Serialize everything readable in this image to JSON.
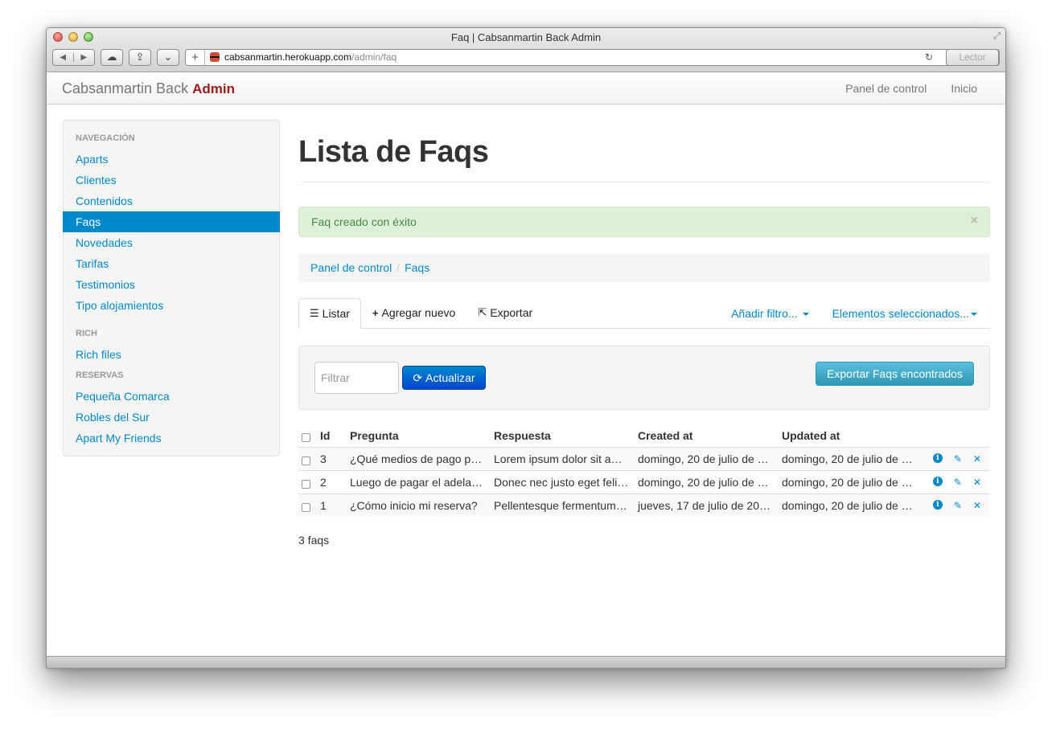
{
  "window": {
    "title": "Faq | Cabsanmartin Back Admin",
    "url_host": "cabsanmartin.herokuapp.com",
    "url_path": "/admin/faq",
    "reader_label": "Lector"
  },
  "navbar": {
    "brand_main": "Cabsanmartin Back",
    "brand_accent": "Admin",
    "links": [
      "Panel de control",
      "Inicio"
    ]
  },
  "sidebar": {
    "sections": [
      {
        "header": "Navegación",
        "items": [
          "Aparts",
          "Clientes",
          "Contenidos",
          "Faqs",
          "Novedades",
          "Tarifas",
          "Testimonios",
          "Tipo alojamientos"
        ]
      },
      {
        "header": "Rich",
        "items": [
          "Rich files"
        ]
      },
      {
        "header": "Reservas",
        "items": [
          "Pequeña Comarca",
          "Robles del Sur",
          "Apart My Friends"
        ]
      }
    ],
    "active_item": "Faqs"
  },
  "main": {
    "title": "Lista de Faqs",
    "alert": "Faq creado con éxito",
    "alert_close": "×",
    "breadcrumb": [
      "Panel de control",
      "Faqs"
    ],
    "tabs": [
      "Listar",
      "Agregar nuevo",
      "Exportar"
    ],
    "tabs_right": [
      "Añadir filtro...",
      "Elementos seleccionados..."
    ],
    "filter_placeholder": "Filtrar",
    "refresh_label": "Actualizar",
    "export_found_label": "Exportar Faqs encontrados",
    "table": {
      "headers": [
        "Id",
        "Pregunta",
        "Respuesta",
        "Created at",
        "Updated at"
      ],
      "rows": [
        [
          "3",
          "¿Qué medios de pago p…",
          "Lorem ipsum dolor sit a…",
          "domingo, 20 de julio de …",
          "domingo, 20 de julio de …"
        ],
        [
          "2",
          "Luego de pagar el adela…",
          "Donec nec justo eget feli…",
          "domingo, 20 de julio de …",
          "domingo, 20 de julio de …"
        ],
        [
          "1",
          "¿Cómo inicio mi reserva?",
          "Pellentesque fermentum…",
          "jueves, 17 de julio de 20…",
          "domingo, 20 de julio de …"
        ]
      ]
    },
    "count": "3 faqs"
  },
  "colors": {
    "link": "#0088cc",
    "accent": "#9b1b1b",
    "success_bg": "#dff0d8"
  }
}
